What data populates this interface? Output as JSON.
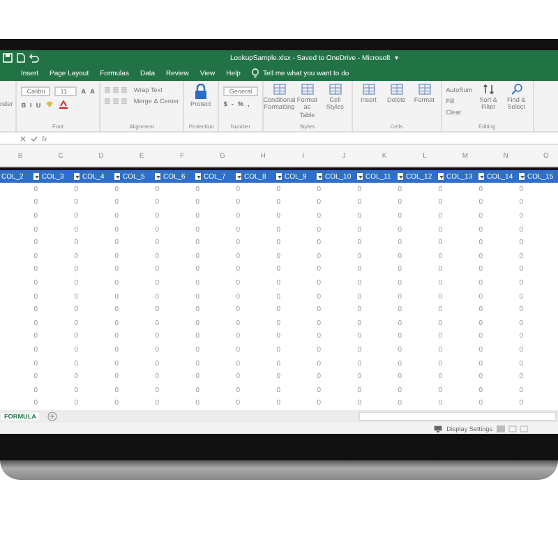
{
  "window": {
    "title": "LookupSample.xlsx - Saved to OneDrive - Microsoft",
    "caret": "▾"
  },
  "ribbon_tabs": [
    {
      "label": "Insert",
      "selected": false
    },
    {
      "label": "Page Layout",
      "selected": false
    },
    {
      "label": "Formulas",
      "selected": false
    },
    {
      "label": "Data",
      "selected": false
    },
    {
      "label": "Review",
      "selected": false
    },
    {
      "label": "View",
      "selected": false
    },
    {
      "label": "Help",
      "selected": false
    }
  ],
  "tell_me": "Tell me what you want to do",
  "left_fragment": "nder",
  "ribbon_groups": [
    {
      "label": "Font",
      "lines": [
        {
          "items": [
            {
              "kind": "field",
              "label": "Calibri"
            },
            {
              "kind": "field",
              "label": "11"
            },
            {
              "kind": "glyph",
              "label": "A"
            },
            {
              "kind": "glyph",
              "label": "A"
            }
          ]
        },
        {
          "items": [
            {
              "kind": "glyph",
              "label": "B"
            },
            {
              "kind": "glyph",
              "label": "I"
            },
            {
              "kind": "glyph",
              "label": "U"
            },
            {
              "kind": "fill"
            },
            {
              "kind": "fontcolor"
            }
          ]
        }
      ]
    },
    {
      "label": "Alignment",
      "lines": [
        {
          "items": [
            {
              "kind": "align"
            },
            {
              "kind": "text",
              "label": "Wrap Text"
            }
          ]
        },
        {
          "items": [
            {
              "kind": "align"
            },
            {
              "kind": "text",
              "label": "Merge & Center"
            }
          ]
        }
      ]
    },
    {
      "label": "Protection",
      "big": [
        {
          "kind": "lock",
          "label": "Protect"
        }
      ]
    },
    {
      "label": "Number",
      "lines": [
        {
          "items": [
            {
              "kind": "field",
              "label": "General"
            }
          ]
        },
        {
          "items": [
            {
              "kind": "glyph",
              "label": "$"
            },
            {
              "kind": "glyph",
              "label": "-"
            },
            {
              "kind": "glyph",
              "label": "%"
            },
            {
              "kind": "glyph",
              "label": ","
            }
          ]
        }
      ]
    },
    {
      "label": "Styles",
      "big": [
        {
          "kind": "grid",
          "label": "Conditional Formatting"
        },
        {
          "kind": "grid",
          "label": "Format as Table"
        },
        {
          "kind": "grid",
          "label": "Cell Styles"
        }
      ]
    },
    {
      "label": "Cells",
      "big": [
        {
          "kind": "grid",
          "label": "Insert"
        },
        {
          "kind": "grid",
          "label": "Delete"
        },
        {
          "kind": "grid",
          "label": "Format"
        }
      ]
    },
    {
      "label": "Editing",
      "lines": [
        {
          "items": [
            {
              "kind": "text",
              "label": "AutoSum"
            }
          ]
        },
        {
          "items": [
            {
              "kind": "text",
              "label": "Fill"
            }
          ]
        },
        {
          "items": [
            {
              "kind": "text",
              "label": "Clear"
            }
          ]
        }
      ],
      "big": [
        {
          "kind": "sort",
          "label": "Sort & Filter"
        },
        {
          "kind": "search",
          "label": "Find & Select"
        }
      ]
    }
  ],
  "formula_bar": {
    "fx": "fx"
  },
  "column_letters": [
    "B",
    "C",
    "D",
    "E",
    "F",
    "G",
    "H",
    "I",
    "J",
    "K",
    "L",
    "M",
    "N",
    "O"
  ],
  "table": {
    "columns": [
      "COL_2",
      "COL_3",
      "COL_4",
      "COL_5",
      "COL_6",
      "COL_7",
      "COL_8",
      "COL_9",
      "COL_10",
      "COL_11",
      "COL_12",
      "COL_13",
      "COL_14",
      "COL_15"
    ],
    "rows": [
      [
        "0",
        "0",
        "0",
        "0",
        "0",
        "0",
        "0",
        "0",
        "0",
        "0",
        "0",
        "0",
        "0"
      ],
      [
        "0",
        "0",
        "0",
        "0",
        "0",
        "0",
        "0",
        "0",
        "0",
        "0",
        "0",
        "0",
        "0"
      ],
      [
        "0",
        "0",
        "0",
        "0",
        "0",
        "0",
        "0",
        "0",
        "0",
        "0",
        "0",
        "0",
        "0"
      ],
      [
        "0",
        "0",
        "0",
        "0",
        "0",
        "0",
        "0",
        "0",
        "0",
        "0",
        "0",
        "0",
        "0"
      ],
      [
        "0",
        "0",
        "0",
        "0",
        "0",
        "0",
        "0",
        "0",
        "0",
        "0",
        "0",
        "0",
        "0"
      ],
      [
        "0",
        "0",
        "0",
        "0",
        "0",
        "0",
        "0",
        "0",
        "0",
        "0",
        "0",
        "0",
        "0"
      ],
      [
        "0",
        "0",
        "0",
        "0",
        "0",
        "0",
        "0",
        "0",
        "0",
        "0",
        "0",
        "0",
        "0"
      ],
      [
        "0",
        "0",
        "0",
        "0",
        "0",
        "0",
        "0",
        "0",
        "0",
        "0",
        "0",
        "0",
        "0"
      ],
      [
        "0",
        "0",
        "0",
        "0",
        "0",
        "0",
        "0",
        "0",
        "0",
        "0",
        "0",
        "0",
        "0"
      ],
      [
        "0",
        "0",
        "0",
        "0",
        "0",
        "0",
        "0",
        "0",
        "0",
        "0",
        "0",
        "0",
        "0"
      ],
      [
        "0",
        "0",
        "0",
        "0",
        "0",
        "0",
        "0",
        "0",
        "0",
        "0",
        "0",
        "0",
        "0"
      ],
      [
        "0",
        "0",
        "0",
        "0",
        "0",
        "0",
        "0",
        "0",
        "0",
        "0",
        "0",
        "0",
        "0"
      ],
      [
        "0",
        "0",
        "0",
        "0",
        "0",
        "0",
        "0",
        "0",
        "0",
        "0",
        "0",
        "0",
        "0"
      ],
      [
        "0",
        "0",
        "0",
        "0",
        "0",
        "0",
        "0",
        "0",
        "0",
        "0",
        "0",
        "0",
        "0"
      ],
      [
        "0",
        "0",
        "0",
        "0",
        "0",
        "0",
        "0",
        "0",
        "0",
        "0",
        "0",
        "0",
        "0"
      ],
      [
        "0",
        "0",
        "0",
        "0",
        "0",
        "0",
        "0",
        "0",
        "0",
        "0",
        "0",
        "0",
        "0"
      ],
      [
        "0",
        "0",
        "0",
        "0",
        "0",
        "0",
        "0",
        "0",
        "0",
        "0",
        "0",
        "0",
        "0"
      ]
    ]
  },
  "sheet_tabs": [
    {
      "label": "FORMULA",
      "selected": true
    }
  ],
  "status_bar": {
    "display_settings": "Display Settings"
  }
}
